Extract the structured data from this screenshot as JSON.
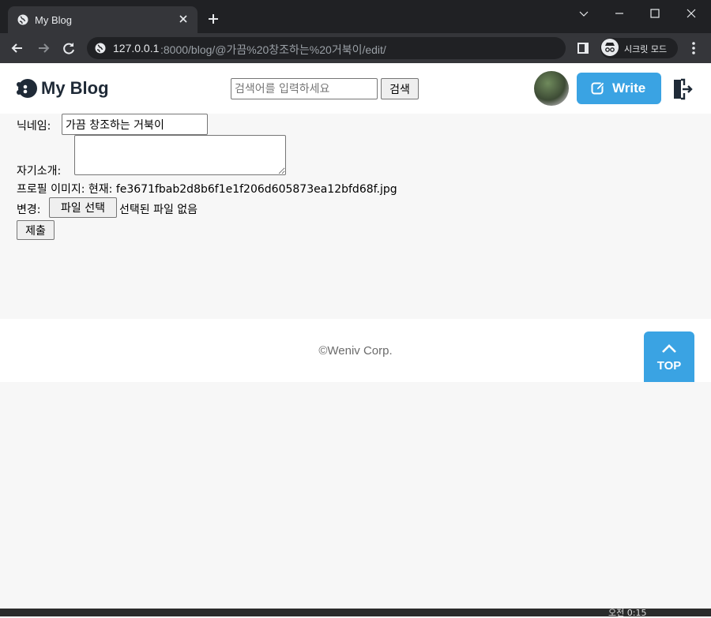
{
  "browser": {
    "tab_title": "My Blog",
    "url_host": "127.0.0.1",
    "url_path": ":8000/blog/@가끔%20창조하는%20거북이/edit/",
    "incognito_label": "시크릿 모드",
    "icons": [
      "globe-icon",
      "close-icon",
      "plus-icon",
      "minimize-icon",
      "maximize-icon",
      "window-close-icon",
      "back-icon",
      "forward-icon",
      "reload-icon",
      "site-info-icon",
      "side-panel-icon",
      "incognito-icon",
      "more-menu-icon"
    ]
  },
  "header": {
    "logo_text": "My Blog",
    "search_placeholder": "검색어를 입력하세요",
    "search_button": "검색",
    "write_button": "Write",
    "accent_color": "#3aa3e3"
  },
  "form": {
    "nickname_label": "닉네임:",
    "nickname_value": "가끔 창조하는 거북이",
    "bio_label": "자기소개:",
    "bio_value": "",
    "profile_image_label": "프로필 이미지: 현재: fe3671fbab2d8b6f1e1f206d605873ea12bfd68f.jpg",
    "change_label": "변경:",
    "file_button": "파일 선택",
    "no_file_text": "선택된 파일 없음",
    "submit_button": "제출"
  },
  "footer": {
    "copyright": "©Weniv Corp.",
    "top_button": "TOP"
  },
  "taskbar": {
    "clock": "오전 0:15"
  }
}
